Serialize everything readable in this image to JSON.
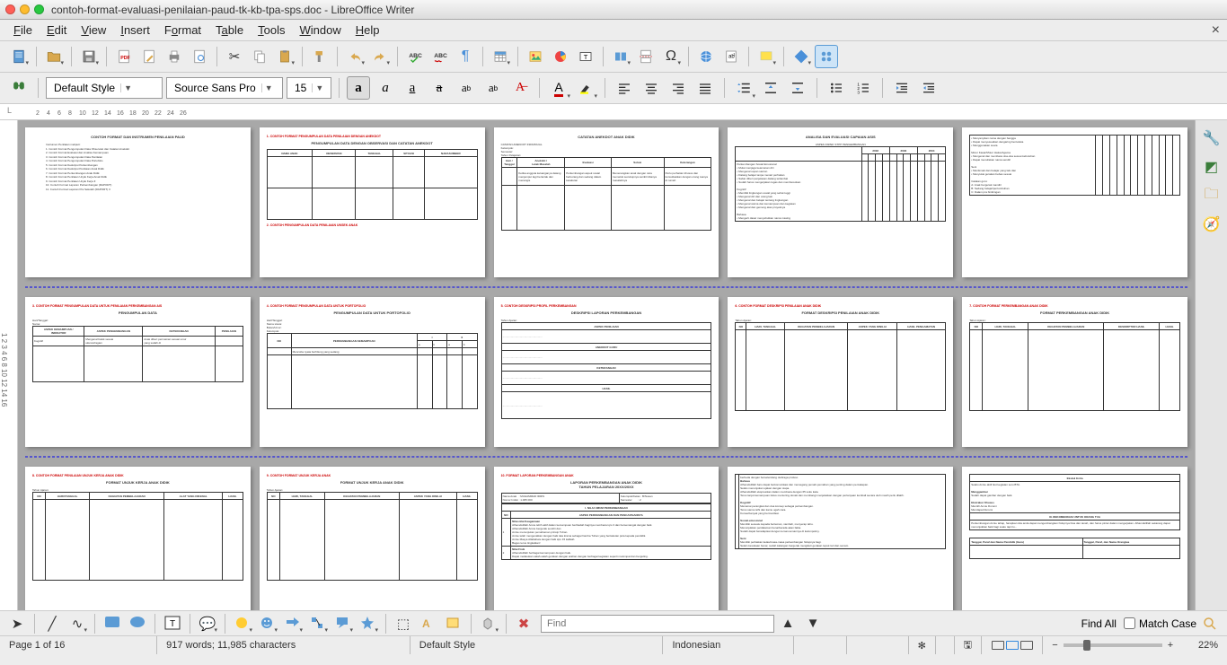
{
  "title": "contoh-format-evaluasi-penilaian-paud-tk-kb-tpa-sps.doc - LibreOffice Writer",
  "menu": [
    "File",
    "Edit",
    "View",
    "Insert",
    "Format",
    "Table",
    "Tools",
    "Window",
    "Help"
  ],
  "fmt": {
    "style": "Default Style",
    "font": "Source Sans Pro",
    "size": "15"
  },
  "find": {
    "placeholder": "Find",
    "findall": "Find All",
    "matchcase": "Match Case"
  },
  "status": {
    "page": "Page 1 of 16",
    "words": "917 words; 11,985 characters",
    "style": "Default Style",
    "lang": "Indonesian",
    "zoom": "22%"
  },
  "pages": {
    "p1_title": "CONTOH FORMAT DAN INSTRUMEN PENILAIAN PAUD",
    "p2_red": "1. CONTOH FORMAT PENGUMPULAN DATA PENILAIAN DENGAN ANEKDOT",
    "p2_title": "PENGUMPULAN DATA DENGAN OBSERVASI DAN CATATAN ANEKDOT",
    "p3_title": "CATATAN ANEKDOT ANAK DIDIK",
    "p3_red": "2. CONTOH PENGUMPULAN DATA PENILAIAN UNSEK ANAK",
    "p4_title": "ANALISA DAN EVALUASI CAPAIAN ASIS",
    "p4_sub": "ASPEK ASPEK STPP PENGEMBANGAN",
    "p6_red": "3. CONTOH FORMAT PENGUMPULAN DATA UNTUK PENILAIAN PERKEMBANGAN AIS",
    "p6_title": "PENGUMPULAN DATA",
    "p7_red": "4. CONTOH FORMAT PENGUMPULAN DATA UNTUK PORTOFOLIO",
    "p7_title": "PENGUMPULAN DATA UNTUK PORTOFOLIO",
    "p8_red": "5. CONTOH DESKRIPSI PROFIL PERKEMBANGAN",
    "p8_title": "DESKRIPSI LAPORAN PERKEMBANGAN",
    "p9_red": "6. CONTOH FORMAT DESKRIPSI PENILAIAN ANAK DIDIK",
    "p9_title": "FORMAT DESKRIPSI PENILAIAN ANAK DIDIK",
    "p10_red": "7. CONTOH FORMAT PERKEMBANGAN ANAK DIDIK",
    "p10_title": "FORMAT PERKEMBANGAN ANAK DIDIK",
    "p11_red": "8. CONTOH FORMAT PENILAIAN UNJUK KERJA ANAK DIDIK",
    "p11_title": "FORMAT UNJUK KERJA ANAK DIDIK",
    "p12_red": "9. CONTOH FORMAT UNJUK KERJA ANAK",
    "p12_title": "FORMAT UNJUK KERJA ANAK DIDIK",
    "p13_red": "10. FORMAT LAPORAN PERKEMBANGAN ANAK",
    "p13_title": "LAPORAN PERKEMBANGAN ANAK DIDIK\nTAHUN PELAJARAN 20XX/20XX"
  }
}
